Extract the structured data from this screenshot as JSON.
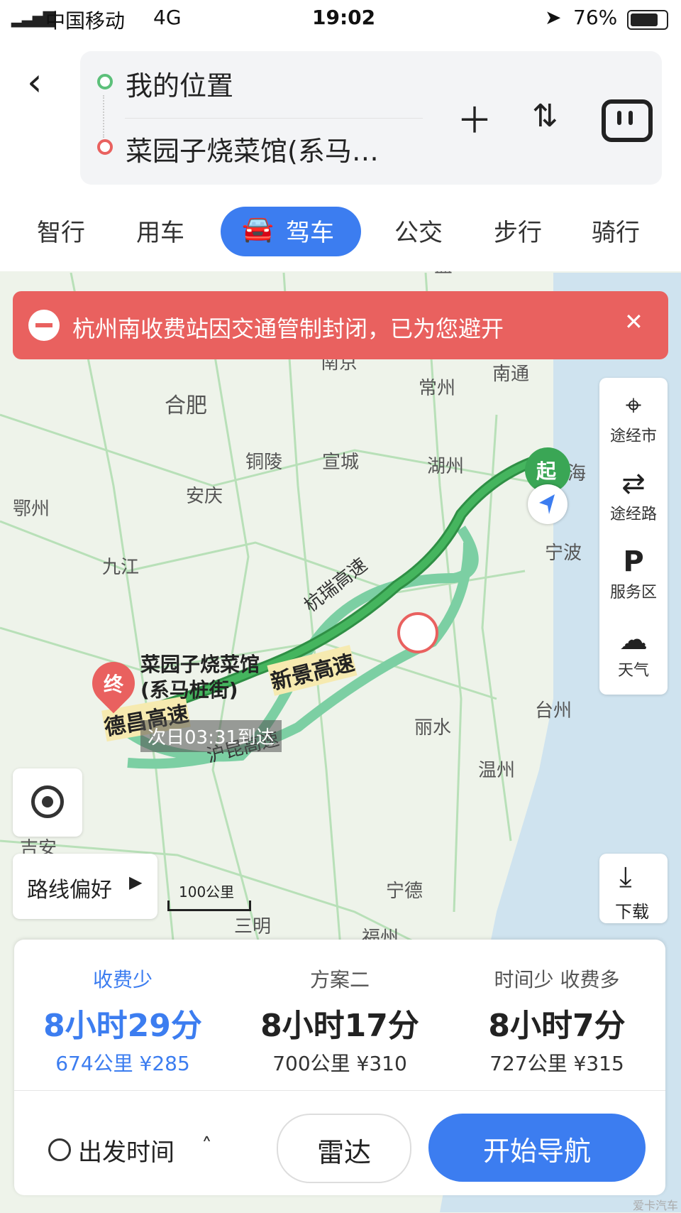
{
  "status_bar": {
    "carrier": "中国移动",
    "network": "4G",
    "time": "19:02",
    "battery": "76%"
  },
  "header": {
    "origin": "我的位置",
    "destination": "菜园子烧菜馆(系马…"
  },
  "modes": [
    "智行",
    "用车",
    "驾车",
    "公交",
    "步行",
    "骑行"
  ],
  "alert": {
    "text": "杭州南收费站因交通管制封闭，已为您避开"
  },
  "tools": [
    {
      "label": "途经市",
      "icon": "pin-icon"
    },
    {
      "label": "途经路",
      "icon": "route-icon"
    },
    {
      "label": "服务区",
      "icon": "parking-icon"
    },
    {
      "label": "天气",
      "icon": "cloud-icon"
    }
  ],
  "map": {
    "cities": [
      "南京",
      "常州",
      "南通",
      "合肥",
      "铜陵",
      "宣城",
      "湖州",
      "安庆",
      "鄂州",
      "九江",
      "宁波",
      "丽水",
      "台州",
      "温州",
      "宁德",
      "三明",
      "福州",
      "吉安",
      "海",
      "盐"
    ],
    "roads": [
      "杭瑞高速",
      "新景高速",
      "德昌高速",
      "沪昆高速"
    ],
    "destination_label": "菜园子烧菜馆(系马桩街)",
    "eta_label": "次日03:31到达",
    "start_marker": "起",
    "end_marker": "终",
    "scale": "100公里",
    "route_pref": "路线偏好",
    "download": "下载"
  },
  "plans": [
    {
      "label": "收费少",
      "time": "8小时29分",
      "dist": "674公里 ¥285"
    },
    {
      "label": "方案二",
      "time": "8小时17分",
      "dist": "700公里 ¥310"
    },
    {
      "label": "时间少  收费多",
      "time": "8小时7分",
      "dist": "727公里 ¥315"
    }
  ],
  "footer": {
    "depart": "出发时间",
    "radar": "雷达",
    "navigate": "开始导航"
  },
  "watermark": "爱卡汽车",
  "colors": {
    "accent": "#3c7df0",
    "alert": "#e9615f",
    "route_main": "#3aa655",
    "route_alt": "#7ccfa3"
  }
}
